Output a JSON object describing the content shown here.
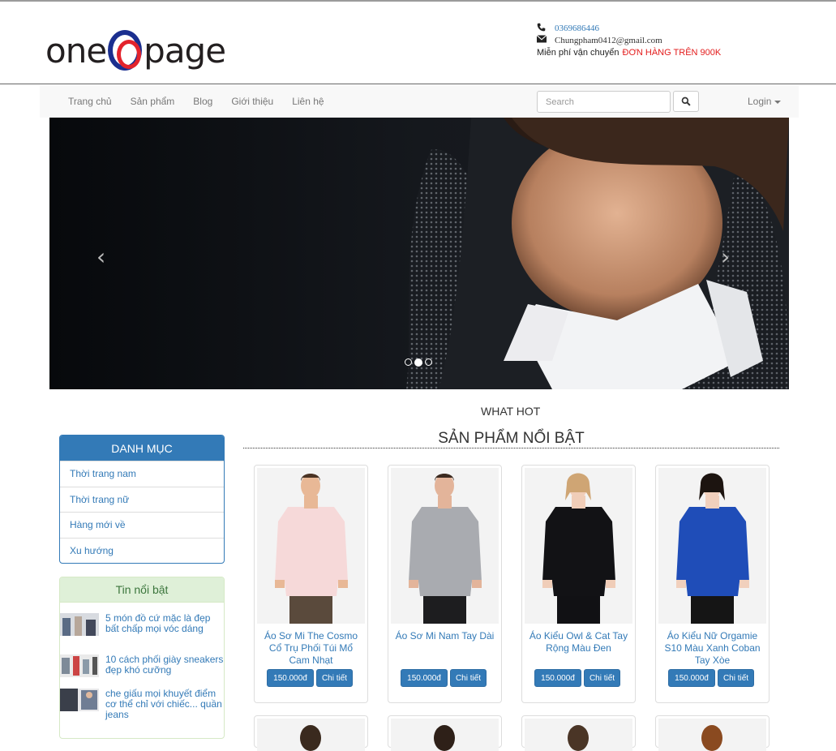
{
  "header": {
    "logo_text_left": "one",
    "logo_text_right": "page",
    "phone": "0369686446",
    "email": "Chungpham0412@gmail.com",
    "shipping_prefix": "Miễn phí vận chuyển",
    "shipping_highlight": "ĐƠN HÀNG TRÊN 900K"
  },
  "nav": {
    "items": [
      {
        "label": "Trang chủ"
      },
      {
        "label": "Sản phẩm"
      },
      {
        "label": "Blog"
      },
      {
        "label": "Giới thiệu"
      },
      {
        "label": "Liên hệ"
      }
    ],
    "search_placeholder": "Search",
    "login_label": "Login"
  },
  "carousel": {
    "prev_icon": "‹",
    "next_icon": "›",
    "active_index": 1,
    "slide_count": 3
  },
  "main": {
    "what_hot": "WHAT HOT",
    "featured_title": "SẢN PHẨM NỔI BẬT"
  },
  "sidebar": {
    "category_title": "DANH MỤC",
    "categories": [
      {
        "label": "Thời trang nam"
      },
      {
        "label": "Thời trang nữ"
      },
      {
        "label": "Hàng mới về"
      },
      {
        "label": "Xu hướng"
      }
    ],
    "news_title": "Tin nổi bật",
    "news": [
      {
        "title": "5 món đồ cứ mặc là đẹp bất chấp mọi vóc dáng"
      },
      {
        "title": "10 cách phối giày sneakers đẹp khó cưỡng"
      },
      {
        "title": "che giấu mọi khuyết điểm cơ thể chỉ với chiếc... quần jeans"
      }
    ]
  },
  "products": [
    {
      "name": "Áo Sơ Mi The Cosmo Cổ Trụ Phối Túi Mổ Cam Nhạt",
      "price": "150.000đ",
      "detail": "Chi tiết",
      "shirt_color": "#f6d9d9",
      "pants_color": "#5a4a3c",
      "skin": "#e8b896",
      "hair": "#4a3324"
    },
    {
      "name": "Áo Sơ Mi Nam Tay Dài",
      "price": "150.000đ",
      "detail": "Chi tiết",
      "shirt_color": "#a9abb0",
      "pants_color": "#1d1d1f",
      "skin": "#e3b49a",
      "hair": "#3b2a20"
    },
    {
      "name": "Áo Kiểu Owl & Cat Tay Rộng Màu Đen",
      "price": "150.000đ",
      "detail": "Chi tiết",
      "shirt_color": "#121215",
      "pants_color": "#111114",
      "skin": "#f0cdb8",
      "hair": "#cfa574"
    },
    {
      "name": "Áo Kiểu Nữ Orgamie S10 Màu Xanh Coban Tay Xòe",
      "price": "150.000đ",
      "detail": "Chi tiết",
      "shirt_color": "#1f4db8",
      "pants_color": "#151515",
      "skin": "#f1d0bd",
      "hair": "#1c1410"
    }
  ]
}
